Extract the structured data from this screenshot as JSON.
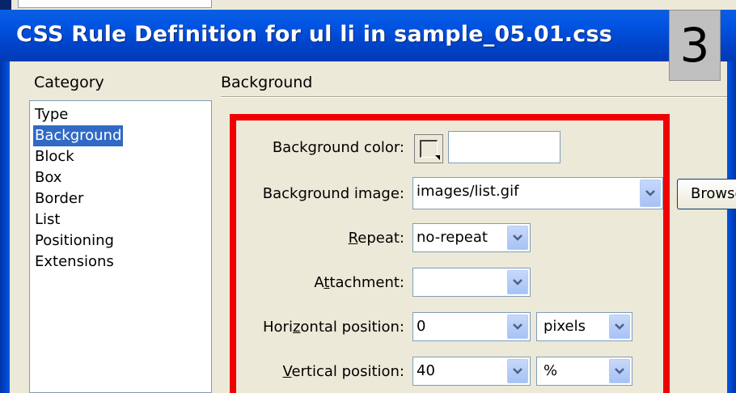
{
  "dialog": {
    "title": "CSS Rule Definition for ul li in sample_05.01.css",
    "step_number": "3"
  },
  "category": {
    "label": "Category",
    "items": [
      "Type",
      "Background",
      "Block",
      "Box",
      "Border",
      "List",
      "Positioning",
      "Extensions"
    ],
    "selected": "Background"
  },
  "section": {
    "title": "Background"
  },
  "fields": {
    "background_color": {
      "label": "Background color:",
      "value": ""
    },
    "background_image": {
      "label": "Background image:",
      "value": "images/list.gif",
      "browse_label": "Browse..."
    },
    "repeat": {
      "label": "Repeat:",
      "value": "no-repeat"
    },
    "attachment": {
      "label": "Attachment:",
      "value": ""
    },
    "horizontal_position": {
      "label": "Horizontal position:",
      "value": "0",
      "unit": "pixels"
    },
    "vertical_position": {
      "label": "Vertical position:",
      "value": "40",
      "unit": "%"
    }
  },
  "colors": {
    "title_bar": "#0054e3",
    "highlight": "#f00000",
    "selection": "#316ac5"
  }
}
